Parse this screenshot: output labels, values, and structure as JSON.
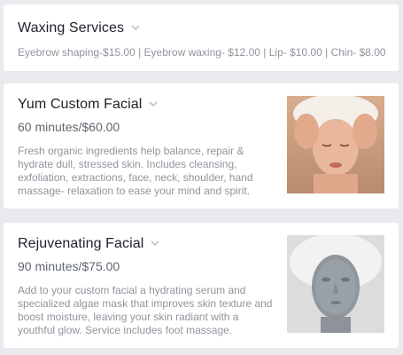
{
  "services": {
    "waxing": {
      "title": "Waxing Services",
      "prices": "Eyebrow shaping-$15.00 | Eyebrow waxing- $12.00 | Lip- $10.00 | Chin- $8.00"
    },
    "yum": {
      "title": "Yum Custom Facial",
      "price": "60 minutes/$60.00",
      "description": "Fresh organic ingredients help balance, repair & hydrate dull, stressed skin. Includes cleansing, exfoliation, extractions, face, neck, shoulder, hand massage- relaxation to ease your mind and spirit."
    },
    "rejuvenating": {
      "title": "Rejuvenating Facial",
      "price": "90 minutes/$75.00",
      "description": "Add to your custom facial a hydrating serum and specialized algae mask that improves skin texture and boost moisture, leaving your skin radiant with a youthful glow. Service includes foot massage."
    }
  },
  "icons": {
    "expand": "chevron-down-icon"
  }
}
